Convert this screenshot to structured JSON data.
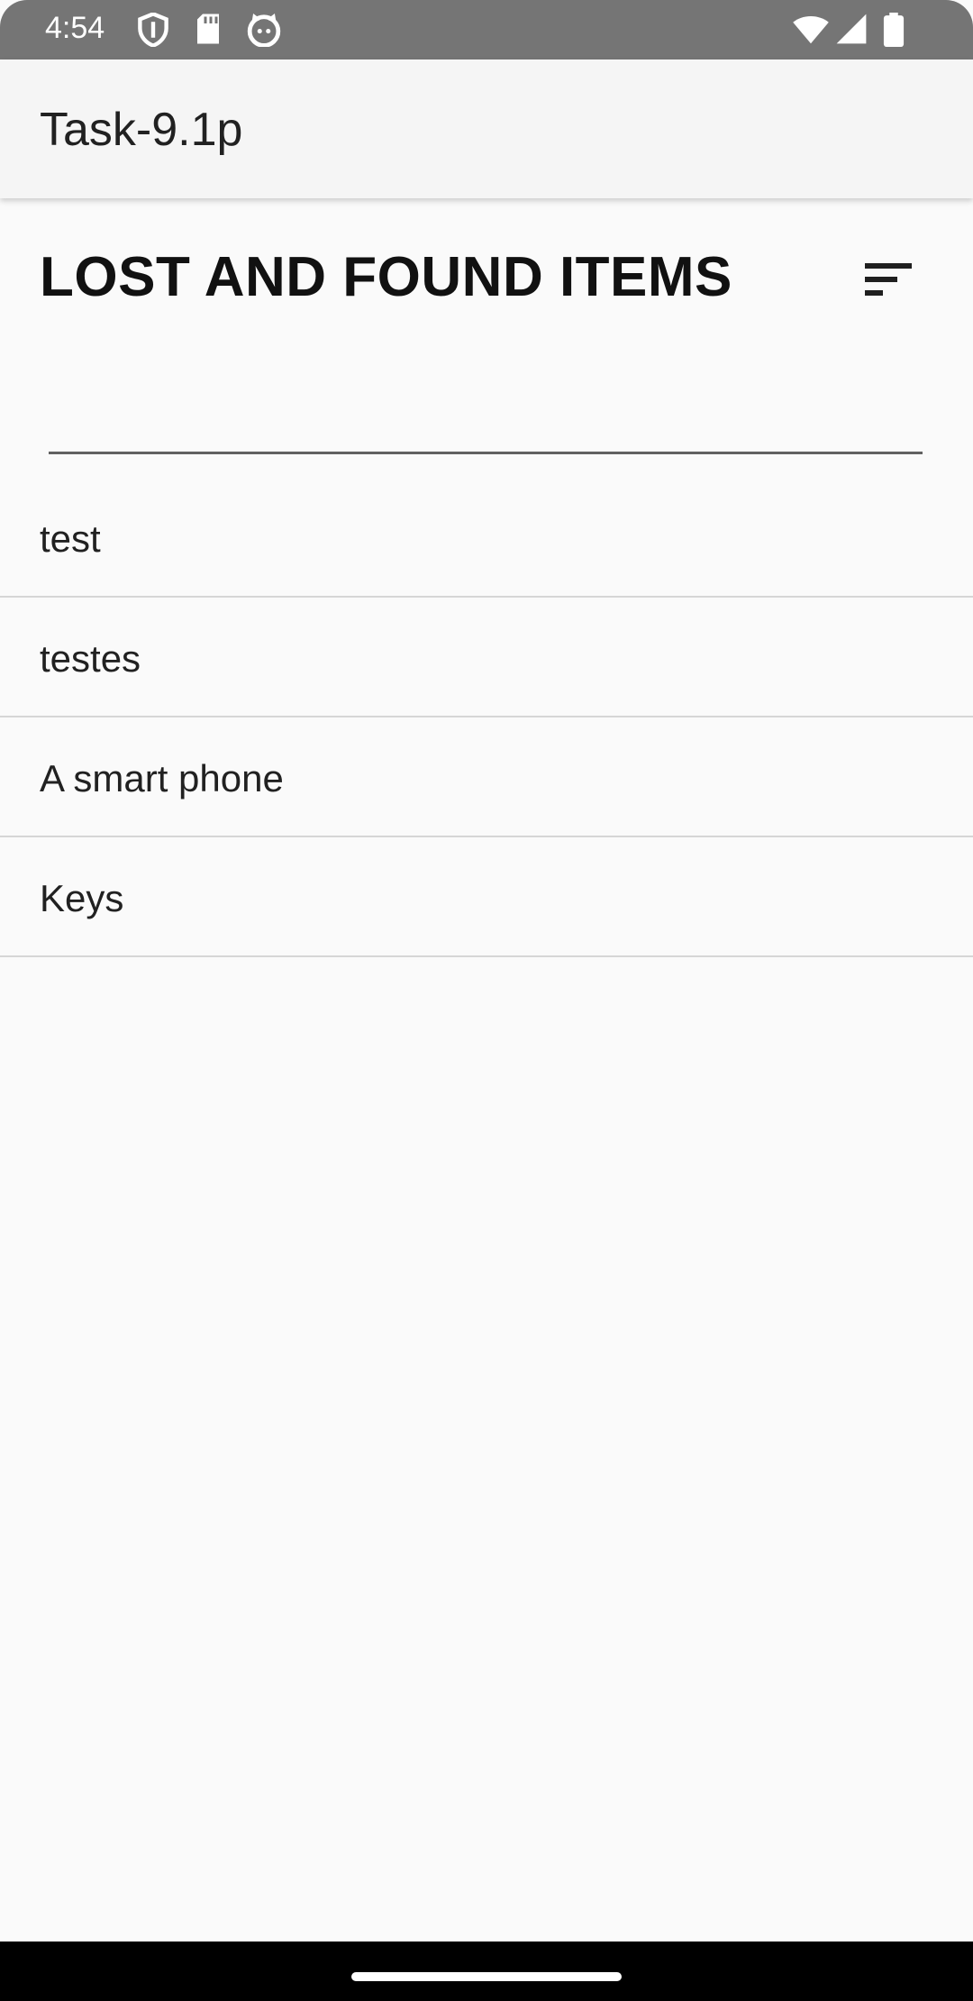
{
  "status_bar": {
    "time": "4:54",
    "icons_left": [
      "shield-icon",
      "sd-card-icon",
      "cat-face-icon"
    ],
    "icons_right": [
      "wifi-icon",
      "signal-icon",
      "battery-icon"
    ]
  },
  "app_bar": {
    "title": "Task-9.1p"
  },
  "main": {
    "heading": "LOST AND FOUND ITEMS",
    "sort_icon": "sort-icon",
    "search": {
      "value": "",
      "placeholder": ""
    },
    "items": [
      {
        "label": "test"
      },
      {
        "label": "testes"
      },
      {
        "label": "A smart phone"
      },
      {
        "label": "Keys"
      }
    ]
  },
  "colors": {
    "status_bar": "#757575",
    "app_bar": "#f5f5f5",
    "background": "#fafafa",
    "divider": "#d6d6d6",
    "nav_bar": "#000000"
  }
}
